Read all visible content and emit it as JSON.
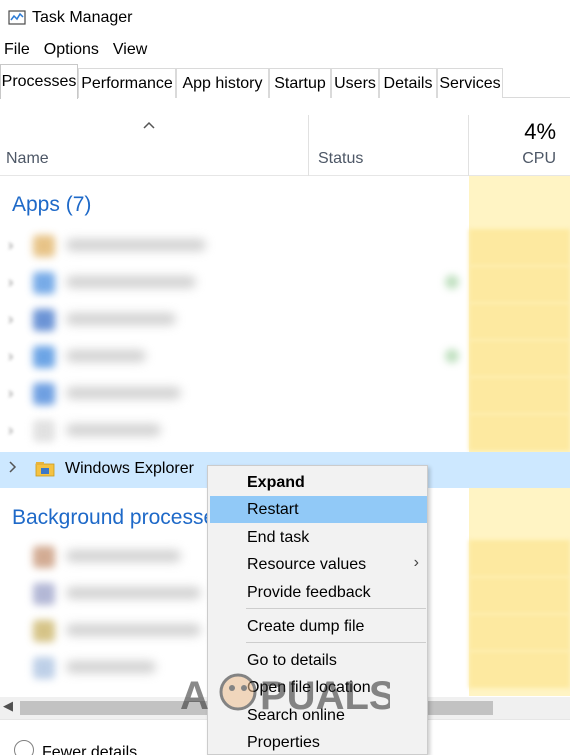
{
  "window": {
    "title": "Task Manager",
    "icon": "task-manager-icon"
  },
  "menubar": {
    "items": [
      "File",
      "Options",
      "View"
    ]
  },
  "tabs": [
    "Processes",
    "Performance",
    "App history",
    "Startup",
    "Users",
    "Details",
    "Services"
  ],
  "active_tab": "Processes",
  "columns": {
    "name": "Name",
    "status": "Status",
    "cpu_percent": "4%",
    "cpu": "CPU"
  },
  "groups": {
    "apps": "Apps (7)",
    "background": "Background processe"
  },
  "selected_process": {
    "name": "Windows Explorer",
    "icon": "folder-icon"
  },
  "context_menu": {
    "expand": "Expand",
    "restart": "Restart",
    "end_task": "End task",
    "resource_values": "Resource values",
    "provide_feedback": "Provide feedback",
    "create_dump_file": "Create dump file",
    "go_to_details": "Go to details",
    "open_file_location": "Open file location",
    "search_online": "Search online",
    "properties": "Properties",
    "hovered_item": "Restart"
  },
  "footer": {
    "fewer_details": "Fewer details"
  },
  "watermark": {
    "text": "APPUALS"
  },
  "colors": {
    "group_label": "#1e69c8",
    "selected_row": "#cde8ff",
    "menu_hover": "#91c9f7",
    "cpu_column": "#fff4c4"
  }
}
